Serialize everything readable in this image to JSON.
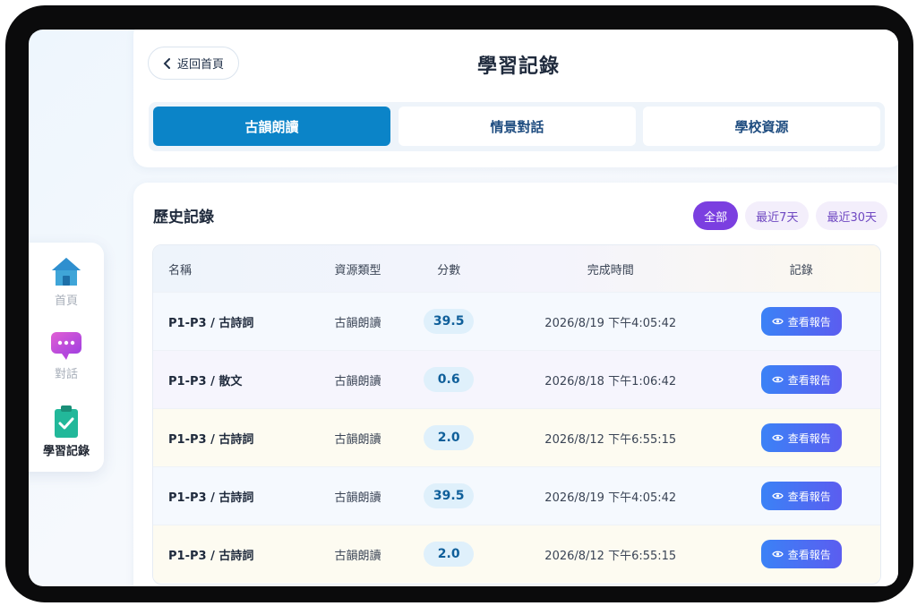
{
  "nav": {
    "items": [
      {
        "label": "首頁",
        "icon": "home-icon"
      },
      {
        "label": "對話",
        "icon": "chat-icon"
      },
      {
        "label": "學習記錄",
        "icon": "clipboard-check-icon"
      }
    ]
  },
  "header": {
    "back_label": "返回首頁",
    "title": "學習記錄",
    "tabs": [
      {
        "label": "古韻朗讀",
        "active": true
      },
      {
        "label": "情景對話",
        "active": false
      },
      {
        "label": "學校資源",
        "active": false
      }
    ]
  },
  "history": {
    "title": "歷史記錄",
    "filters": [
      {
        "label": "全部",
        "active": true
      },
      {
        "label": "最近7天",
        "active": false
      },
      {
        "label": "最近30天",
        "active": false
      }
    ],
    "columns": [
      "名稱",
      "資源類型",
      "分數",
      "完成時間",
      "記錄"
    ],
    "rows": [
      {
        "name": "P1-P3 / 古詩詞",
        "type": "古韻朗讀",
        "score": "39.5",
        "time": "2026/8/19 下午4:05:42",
        "action": "查看報告"
      },
      {
        "name": "P1-P3 / 散文",
        "type": "古韻朗讀",
        "score": "0.6",
        "time": "2026/8/18 下午1:06:42",
        "action": "查看報告"
      },
      {
        "name": "P1-P3 / 古詩詞",
        "type": "古韻朗讀",
        "score": "2.0",
        "time": "2026/8/12 下午6:55:15",
        "action": "查看報告"
      },
      {
        "name": "P1-P3 / 古詩詞",
        "type": "古韻朗讀",
        "score": "39.5",
        "time": "2026/8/19 下午4:05:42",
        "action": "查看報告"
      },
      {
        "name": "P1-P3 / 古詩詞",
        "type": "古韻朗讀",
        "score": "2.0",
        "time": "2026/8/12 下午6:55:15",
        "action": "查看報告"
      }
    ]
  },
  "colors": {
    "accent_tab": "#0b84c8",
    "filter_active": "#7b3fe0",
    "button_gradient_start": "#3b82f6",
    "button_gradient_end": "#5b5df0"
  }
}
